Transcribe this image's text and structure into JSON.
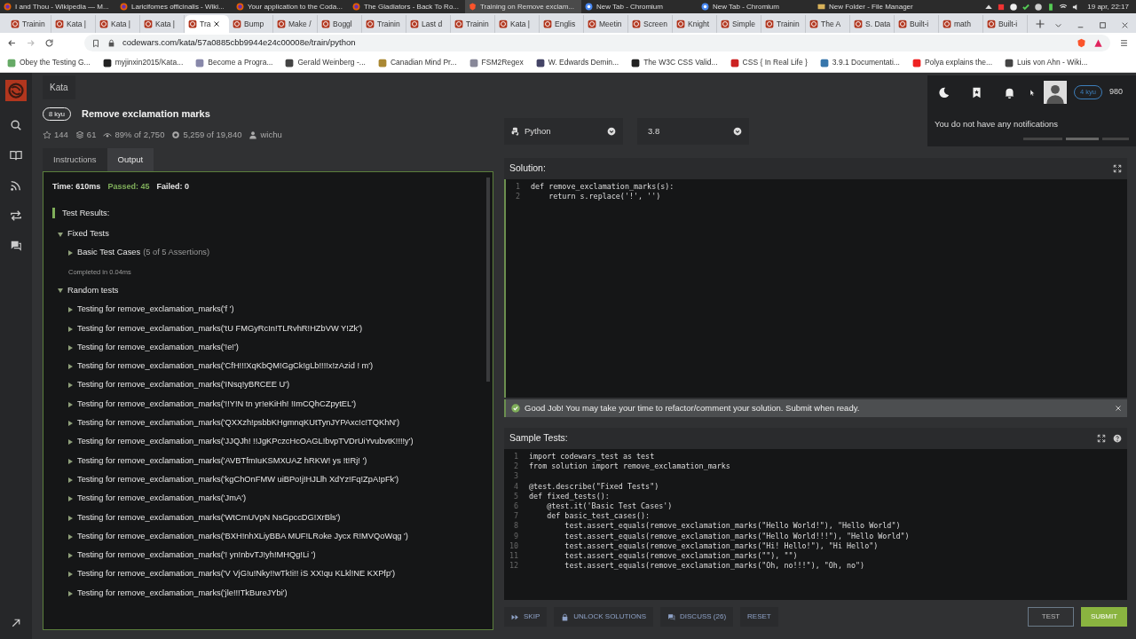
{
  "os_panel": {
    "windows": [
      {
        "title": "I and Thou - Wikipedia — M...",
        "kind": "firefox",
        "selected": false
      },
      {
        "title": "Laricifomes officinalis - Wiki...",
        "kind": "firefox",
        "selected": false
      },
      {
        "title": "Your application to the Coda...",
        "kind": "firefox",
        "selected": false
      },
      {
        "title": "The Gladiators - Back To Ro...",
        "kind": "firefox",
        "selected": false
      },
      {
        "title": "Training on Remove exclam...",
        "kind": "brave",
        "selected": true
      },
      {
        "title": "New Tab - Chromium",
        "kind": "chromium",
        "selected": false
      },
      {
        "title": "New Tab - Chromium",
        "kind": "chromium",
        "selected": false
      },
      {
        "title": "New Folder - File Manager",
        "kind": "files",
        "selected": false
      }
    ],
    "clock": "19 apr, 22:17"
  },
  "browser": {
    "tabs": [
      {
        "label": "Trainin",
        "selected": false
      },
      {
        "label": "Kata |",
        "selected": false
      },
      {
        "label": "Kata |",
        "selected": false
      },
      {
        "label": "Kata |",
        "selected": false
      },
      {
        "label": "Tra",
        "selected": true
      },
      {
        "label": "Bump",
        "selected": false
      },
      {
        "label": "Make /",
        "selected": false
      },
      {
        "label": "Boggl",
        "selected": false
      },
      {
        "label": "Trainin",
        "selected": false
      },
      {
        "label": "Last d",
        "selected": false
      },
      {
        "label": "Trainin",
        "selected": false
      },
      {
        "label": "Kata |",
        "selected": false
      },
      {
        "label": "Englis",
        "selected": false
      },
      {
        "label": "Meetin",
        "selected": false
      },
      {
        "label": "Screen",
        "selected": false
      },
      {
        "label": "Knight",
        "selected": false
      },
      {
        "label": "Simple",
        "selected": false
      },
      {
        "label": "Trainin",
        "selected": false
      },
      {
        "label": "The A",
        "selected": false
      },
      {
        "label": "S. Data",
        "selected": false
      },
      {
        "label": "Built-i",
        "selected": false
      },
      {
        "label": "math",
        "selected": false
      },
      {
        "label": "Built-i",
        "selected": false
      }
    ],
    "url": "codewars.com/kata/57a0885cbb9944e24c00008e/train/python",
    "bookmarks": [
      "Obey the Testing G...",
      "myjinxin2015/Kata...",
      "Become a Progra...",
      "Gerald Weinberg -...",
      "Canadian Mind Pr...",
      "FSM2Regex",
      "W. Edwards Demin...",
      "The W3C CSS Valid...",
      "CSS { In Real Life }",
      "3.9.1 Documentati...",
      "Polya explains the...",
      "Luis von Ahn - Wiki..."
    ]
  },
  "site": {
    "breadcrumb": "Kata",
    "user": {
      "rank": "4 kyu",
      "honor": "980"
    },
    "notifications": "You do not have any notifications"
  },
  "kata": {
    "rank": "8 kyu",
    "title": "Remove exclamation marks",
    "stats": [
      {
        "kind": "star",
        "text": "144"
      },
      {
        "kind": "collections",
        "text": "61"
      },
      {
        "kind": "satisfaction",
        "text": "89% of 2,750"
      },
      {
        "kind": "completed",
        "text": "5,259 of 19,840"
      },
      {
        "kind": "author",
        "text": "wichu"
      }
    ]
  },
  "panel_tabs": [
    {
      "label": "Instructions",
      "selected": false
    },
    {
      "label": "Output",
      "selected": true
    }
  ],
  "output": {
    "summary": [
      {
        "kind": "time",
        "text": "Time: 610ms"
      },
      {
        "kind": "passed",
        "text": "Passed: 45"
      },
      {
        "kind": "failed",
        "text": "Failed: 0"
      }
    ],
    "heading": "Test Results:",
    "groups": [
      {
        "label": "Fixed Tests",
        "expanded": true,
        "completed": "Completed in 0.04ms",
        "children": [
          {
            "label": "Basic Test Cases",
            "note": "(5 of 5 Assertions)",
            "expanded": false
          }
        ]
      },
      {
        "label": "Random tests",
        "expanded": true,
        "children": [
          {
            "label": "Testing for remove_exclamation_marks('f ')",
            "expanded": false
          },
          {
            "label": "Testing for remove_exclamation_marks('tU FMGyRcIn!TLRvhR!HZbVW Y!Zk')",
            "expanded": false
          },
          {
            "label": "Testing for remove_exclamation_marks('!e!')",
            "expanded": false
          },
          {
            "label": "Testing for remove_exclamation_marks('CfH!!!XqKbQM!GgCk!gLb!!!!x!zAzid ! m')",
            "expanded": false
          },
          {
            "label": "Testing for remove_exclamation_marks('INsq!yBRCEE U')",
            "expanded": false
          },
          {
            "label": "Testing for remove_exclamation_marks('!!Y!N tn yr!eKiHh! !ImCQhCZpytEL')",
            "expanded": false
          },
          {
            "label": "Testing for remove_exclamation_marks('QXXzh!psbbKHgmnqKUtTynJYPAxc!c!TQKhN')",
            "expanded": false
          },
          {
            "label": "Testing for remove_exclamation_marks('JJQJh! !!JgKPczcHcOAGL!bvpTVDrUiYvubvtK!!!!y')",
            "expanded": false
          },
          {
            "label": "Testing for remove_exclamation_marks('AVBTfmIuKSMXUAZ hRKW! ys !t!Rj! ')",
            "expanded": false
          },
          {
            "label": "Testing for remove_exclamation_marks('kgChOnFMW uiBPo!j!HJLlh  XdYz!Fq!ZpA!pFk')",
            "expanded": false
          },
          {
            "label": "Testing for remove_exclamation_marks('JmA')",
            "expanded": false
          },
          {
            "label": "Testing for remove_exclamation_marks('WtCmUVpN NsGpccDG!XrBls')",
            "expanded": false
          },
          {
            "label": "Testing for remove_exclamation_marks('BXH!nhXLiyBBA MUF!LRoke Jycx R!MVQoWqg ')",
            "expanded": false
          },
          {
            "label": "Testing for remove_exclamation_marks('!  yn!nbvTJ!yh!MHQg!Li ')",
            "expanded": false
          },
          {
            "label": "Testing for remove_exclamation_marks('V VjG!u!Nky!!wTk!i!! iS XX!qu KLkl!NE KXPfp')",
            "expanded": false
          },
          {
            "label": "Testing for remove_exclamation_marks('jle!!!TkBureJYbi')",
            "expanded": false
          }
        ]
      }
    ]
  },
  "editor": {
    "language": "Python",
    "version": "3.8",
    "solution": {
      "title": "Solution:",
      "lines": [
        {
          "n": "1",
          "code": "def remove_exclamation_marks(s):"
        },
        {
          "n": "2",
          "code": "    return s.replace('!', '')"
        }
      ]
    },
    "alert": "Good Job! You may take your time to refactor/comment your solution. Submit when ready.",
    "sample_tests": {
      "title": "Sample Tests:",
      "lines": [
        {
          "n": "1",
          "code": "import codewars_test as test"
        },
        {
          "n": "2",
          "code": "from solution import remove_exclamation_marks"
        },
        {
          "n": "3"
        },
        {
          "n": "4",
          "code": "@test.describe(\"Fixed Tests\")"
        },
        {
          "n": "5",
          "code": "def fixed_tests():"
        },
        {
          "n": "6",
          "code": "    @test.it('Basic Test Cases')"
        },
        {
          "n": "7",
          "code": "    def basic_test_cases():"
        },
        {
          "n": "8",
          "code": "        test.assert_equals(remove_exclamation_marks(\"Hello World!\"), \"Hello World\")"
        },
        {
          "n": "9",
          "code": "        test.assert_equals(remove_exclamation_marks(\"Hello World!!!\"), \"Hello World\")"
        },
        {
          "n": "10",
          "code": "        test.assert_equals(remove_exclamation_marks(\"Hi! Hello!\"), \"Hi Hello\")"
        },
        {
          "n": "11",
          "code": "        test.assert_equals(remove_exclamation_marks(\"\"), \"\")"
        },
        {
          "n": "12",
          "code": "        test.assert_equals(remove_exclamation_marks(\"Oh, no!!!\"), \"Oh, no\")"
        }
      ]
    }
  },
  "actions": [
    {
      "label": "SKIP",
      "kind": "skip"
    },
    {
      "label": "UNLOCK SOLUTIONS",
      "kind": "unlock"
    },
    {
      "label": "DISCUSS (26)",
      "kind": "discuss"
    },
    {
      "label": "RESET",
      "kind": "reset"
    }
  ],
  "run_buttons": [
    {
      "label": "TEST",
      "kind": "outline"
    },
    {
      "label": "SUBMIT",
      "kind": "primary"
    }
  ]
}
